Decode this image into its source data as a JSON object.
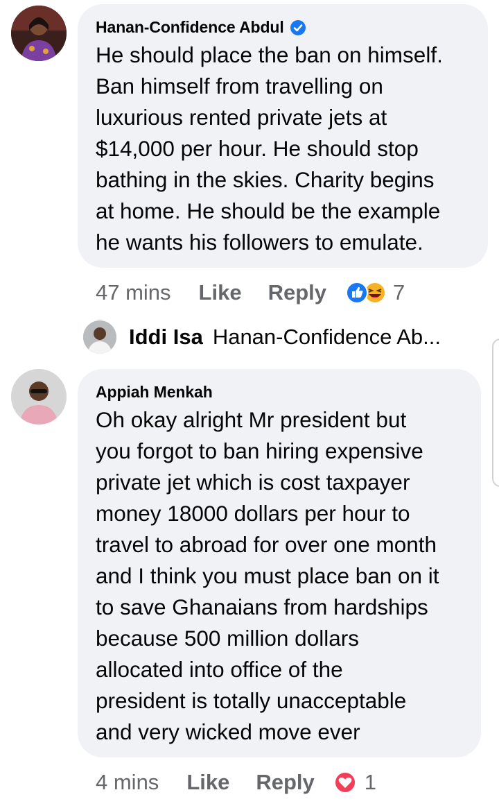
{
  "comments": [
    {
      "author": "Hanan-Confidence Abdul",
      "verified": true,
      "text_lines": [
        "He should place the ban on himself.",
        "Ban himself from travelling on",
        "luxurious rented private jets at",
        "$14,000 per hour. He should stop",
        "bathing in the skies. Charity begins",
        "at home. He should be the example",
        "he wants his followers to emulate."
      ],
      "time": "47 mins",
      "like_label": "Like",
      "reply_label": "Reply",
      "reaction_icons": [
        "like-reaction-icon",
        "haha-reaction-icon"
      ],
      "reaction_count": "7",
      "reply_preview": {
        "author": "Iddi Isa",
        "text": "Hanan-Confidence Ab..."
      }
    },
    {
      "author": "Appiah Menkah",
      "verified": false,
      "text_lines": [
        "Oh okay alright Mr president but",
        "you forgot to ban hiring expensive",
        "private jet which is cost taxpayer",
        "money 18000 dollars per hour to",
        "travel to abroad for over one month",
        "and I think you must place ban on it",
        "to save Ghanaians from hardships",
        "because 500 million dollars",
        "allocated into office of the",
        "president is totally unacceptable",
        "and very wicked move ever"
      ],
      "time": "4 mins",
      "like_label": "Like",
      "reply_label": "Reply",
      "reaction_icons": [
        "love-reaction-icon"
      ],
      "reaction_count": "1"
    }
  ],
  "colors": {
    "bubble": "#f0f2f5",
    "meta_text": "#65676b",
    "verified_blue": "#1877f2",
    "love_red": "#f33e58",
    "haha_yellow": "#f7b125"
  }
}
